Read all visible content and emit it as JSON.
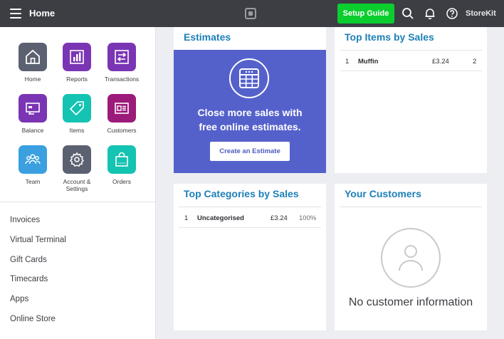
{
  "topbar": {
    "title": "Home",
    "setup_label": "Setup Guide",
    "account_label": "StoreKit",
    "icons": [
      "menu-icon",
      "square-logo-icon",
      "search-icon",
      "bell-icon",
      "help-icon"
    ]
  },
  "apps": [
    {
      "label": "Home",
      "icon": "home-icon",
      "color": "#5b6170"
    },
    {
      "label": "Reports",
      "icon": "bar-chart-icon",
      "color": "#7a35b4"
    },
    {
      "label": "Transactions",
      "icon": "exchange-icon",
      "color": "#7a35b4"
    },
    {
      "label": "Balance",
      "icon": "card-icon",
      "color": "#7a35b4"
    },
    {
      "label": "Items",
      "icon": "tag-icon",
      "color": "#14c3b1"
    },
    {
      "label": "Customers",
      "icon": "contact-card-icon",
      "color": "#9b1a7a"
    },
    {
      "label": "Team",
      "icon": "team-icon",
      "color": "#3aa0e0"
    },
    {
      "label": "Account &\nSettings",
      "icon": "gear-icon",
      "color": "#5b6170"
    },
    {
      "label": "Orders",
      "icon": "bag-icon",
      "color": "#14c3b1"
    }
  ],
  "nav": [
    "Invoices",
    "Virtual Terminal",
    "Gift Cards",
    "Timecards",
    "Apps",
    "Online Store"
  ],
  "estimates": {
    "title": "Estimates",
    "text_line1": "Close more sales with",
    "text_line2": "free online estimates.",
    "button": "Create an Estimate",
    "bg_color": "#5561cb"
  },
  "top_items": {
    "title": "Top Items by Sales",
    "rows": [
      {
        "rank": "1",
        "name": "Muffin",
        "sales": "£3.24",
        "qty": "2"
      }
    ]
  },
  "top_categories": {
    "title": "Top Categories by Sales",
    "rows": [
      {
        "rank": "1",
        "name": "Uncategorised",
        "sales": "£3.24",
        "pct": "100%"
      }
    ]
  },
  "customers": {
    "title": "Your Customers",
    "empty_text": "No customer information"
  },
  "colors": {
    "accent": "#1d7fb8",
    "setup_green": "#0ccd2e",
    "topbar": "#3c3e44"
  }
}
